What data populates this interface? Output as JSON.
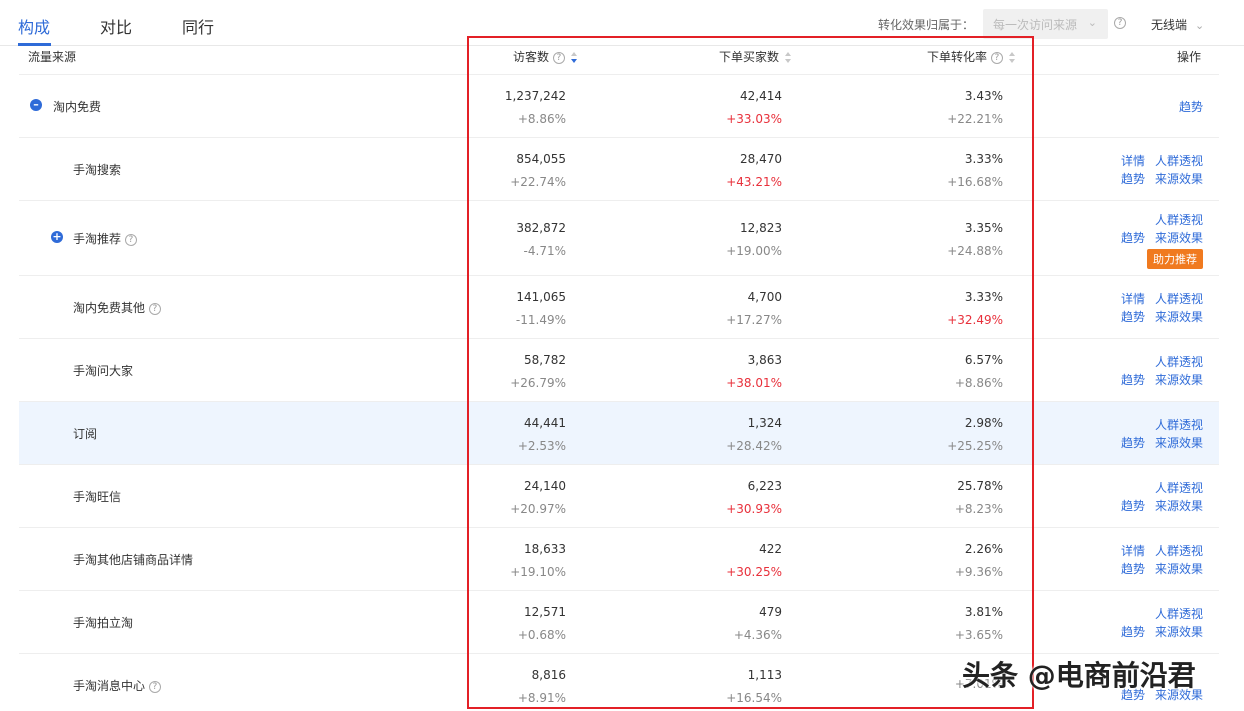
{
  "tabs": [
    {
      "label": "构成",
      "active": true
    },
    {
      "label": "对比",
      "active": false
    },
    {
      "label": "同行",
      "active": false
    }
  ],
  "attribution": {
    "label": "转化效果归属于：",
    "value": "每一次访问来源"
  },
  "device": "无线端",
  "header": {
    "source": "流量来源",
    "visitors": "访客数",
    "buyers": "下单买家数",
    "conv": "下单转化率",
    "ops": "操作"
  },
  "rows": [
    {
      "name": "淘内免费",
      "visitors": "1,237,242",
      "visitors_chg": "+8.86%",
      "buyers": "42,414",
      "buyers_chg": "+33.03%",
      "conv": "3.43%",
      "conv_chg": "+22.21%",
      "ops": [
        [
          "趋势"
        ]
      ]
    },
    {
      "name": "手淘搜索",
      "visitors": "854,055",
      "visitors_chg": "+22.74%",
      "buyers": "28,470",
      "buyers_chg": "+43.21%",
      "conv": "3.33%",
      "conv_chg": "+16.68%",
      "ops": [
        [
          "详情",
          "人群透视"
        ],
        [
          "趋势",
          "来源效果"
        ]
      ]
    },
    {
      "name": "手淘推荐",
      "visitors": "382,872",
      "visitors_chg": "-4.71%",
      "buyers": "12,823",
      "buyers_chg": "+19.00%",
      "conv": "3.35%",
      "conv_chg": "+24.88%",
      "ops": [
        [
          "人群透视"
        ],
        [
          "趋势",
          "来源效果"
        ]
      ],
      "badge": "助力推荐"
    },
    {
      "name": "淘内免费其他",
      "visitors": "141,065",
      "visitors_chg": "-11.49%",
      "buyers": "4,700",
      "buyers_chg": "+17.27%",
      "conv": "3.33%",
      "conv_chg": "+32.49%",
      "ops": [
        [
          "详情",
          "人群透视"
        ],
        [
          "趋势",
          "来源效果"
        ]
      ]
    },
    {
      "name": "手淘问大家",
      "visitors": "58,782",
      "visitors_chg": "+26.79%",
      "buyers": "3,863",
      "buyers_chg": "+38.01%",
      "conv": "6.57%",
      "conv_chg": "+8.86%",
      "ops": [
        [
          "人群透视"
        ],
        [
          "趋势",
          "来源效果"
        ]
      ]
    },
    {
      "name": "订阅",
      "visitors": "44,441",
      "visitors_chg": "+2.53%",
      "buyers": "1,324",
      "buyers_chg": "+28.42%",
      "conv": "2.98%",
      "conv_chg": "+25.25%",
      "ops": [
        [
          "人群透视"
        ],
        [
          "趋势",
          "来源效果"
        ]
      ]
    },
    {
      "name": "手淘旺信",
      "visitors": "24,140",
      "visitors_chg": "+20.97%",
      "buyers": "6,223",
      "buyers_chg": "+30.93%",
      "conv": "25.78%",
      "conv_chg": "+8.23%",
      "ops": [
        [
          "人群透视"
        ],
        [
          "趋势",
          "来源效果"
        ]
      ]
    },
    {
      "name": "手淘其他店铺商品详情",
      "visitors": "18,633",
      "visitors_chg": "+19.10%",
      "buyers": "422",
      "buyers_chg": "+30.25%",
      "conv": "2.26%",
      "conv_chg": "+9.36%",
      "ops": [
        [
          "详情",
          "人群透视"
        ],
        [
          "趋势",
          "来源效果"
        ]
      ]
    },
    {
      "name": "手淘拍立淘",
      "visitors": "12,571",
      "visitors_chg": "+0.68%",
      "buyers": "479",
      "buyers_chg": "+4.36%",
      "conv": "3.81%",
      "conv_chg": "+3.65%",
      "ops": [
        [
          "人群透视"
        ],
        [
          "趋势",
          "来源效果"
        ]
      ]
    },
    {
      "name": "手淘消息中心",
      "visitors": "8,816",
      "visitors_chg": "+8.91%",
      "buyers": "1,113",
      "buyers_chg": "+16.54%",
      "conv": "",
      "conv_chg": "+7.01%",
      "ops": [
        [
          "趋势",
          "来源效果"
        ]
      ]
    }
  ],
  "watermark": "头条 @电商前沿君",
  "colors": {
    "accent": "#2f6bd8",
    "red": "#e8303b",
    "highlight_box": "#e32026",
    "badge": "#f07a1f"
  }
}
